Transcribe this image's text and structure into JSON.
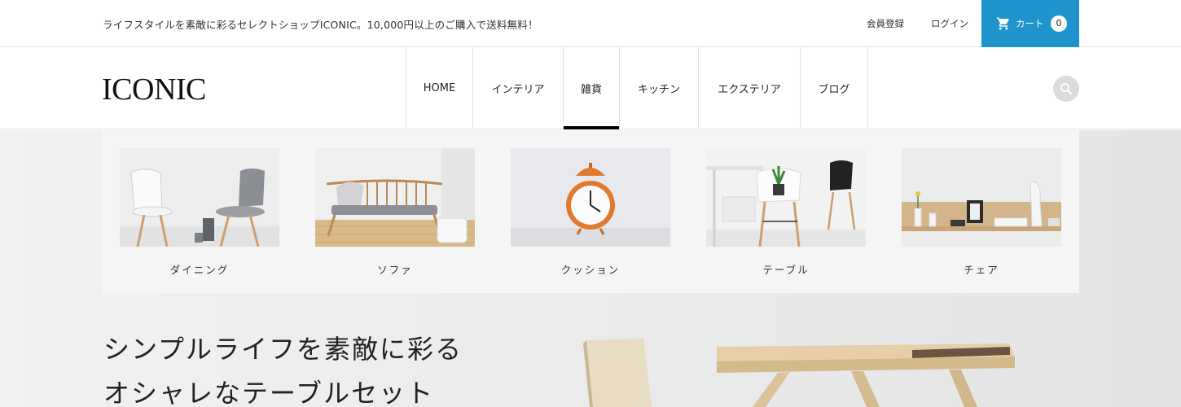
{
  "topbar": {
    "announcement": "ライフスタイルを素敵に彩るセレクトショップICONIC。10,000円以上のご購入で送料無料！",
    "register_label": "会員登録",
    "login_label": "ログイン",
    "cart": {
      "label": "カート",
      "count": "0",
      "icon": "cart-icon",
      "background": "#1f94cc"
    }
  },
  "header": {
    "logo": "ICONIC",
    "nav": [
      {
        "label": "HOME",
        "active": false
      },
      {
        "label": "インテリア",
        "active": false
      },
      {
        "label": "雑貨",
        "active": true
      },
      {
        "label": "キッチン",
        "active": false
      },
      {
        "label": "エクステリア",
        "active": false
      },
      {
        "label": "ブログ",
        "active": false
      }
    ],
    "search_icon": "search-icon"
  },
  "megamenu": {
    "items": [
      {
        "label": "ダイニング",
        "image": "dining-chairs"
      },
      {
        "label": "ソファ",
        "image": "wooden-bench-sofa"
      },
      {
        "label": "クッション",
        "image": "orange-alarm-clock"
      },
      {
        "label": "テーブル",
        "image": "white-chair-with-plant"
      },
      {
        "label": "チェア",
        "image": "wall-shelf-with-vases"
      }
    ]
  },
  "hero": {
    "title_line1": "シンプルライフを素敵に彩る",
    "title_line2": "オシャレなテーブルセット"
  }
}
